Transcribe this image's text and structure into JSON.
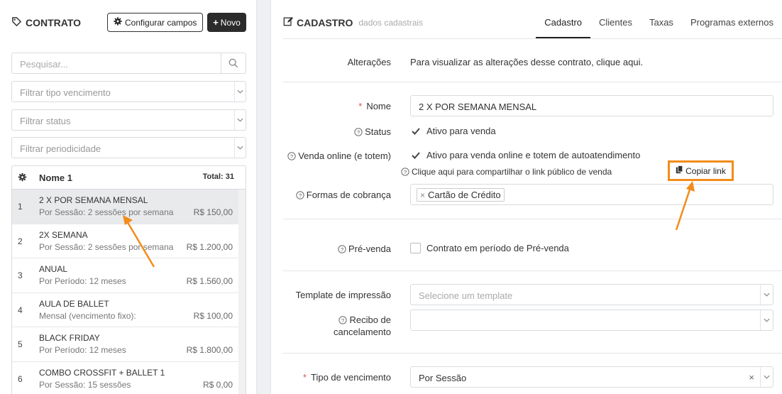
{
  "left": {
    "title": "CONTRATO",
    "config_button": "Configurar campos",
    "new_button": "Novo",
    "search_placeholder": "Pesquisar...",
    "filters": [
      "Filtrar tipo vencimento",
      "Filtrar status",
      "Filtrar periodicidade"
    ],
    "list": {
      "header_name": "Nome 1",
      "header_total": "Total: 31",
      "rows": [
        {
          "idx": "1",
          "name": "2 X POR SEMANA MENSAL",
          "detail": "Por Sessão: 2 sessões por semana",
          "price": "R$ 150,00",
          "selected": true
        },
        {
          "idx": "2",
          "name": "2X SEMANA",
          "detail": "Por Sessão: 2 sessões por semana",
          "price": "R$ 1.200,00"
        },
        {
          "idx": "3",
          "name": "ANUAL",
          "detail": "Por Período: 12 meses",
          "price": "R$ 1.560,00"
        },
        {
          "idx": "4",
          "name": "AULA DE BALLET",
          "detail": "Mensal (vencimento fixo):",
          "price": "R$ 100,00"
        },
        {
          "idx": "5",
          "name": "BLACK FRIDAY",
          "detail": "Por Período: 12 meses",
          "price": "R$ 1.800,00"
        },
        {
          "idx": "6",
          "name": "COMBO CROSSFIT + BALLET 1",
          "detail": "Por Sessão: 15 sessões",
          "price": "R$ 0,00"
        }
      ]
    }
  },
  "right": {
    "title": "CADASTRO",
    "subtitle": "dados cadastrais",
    "tabs": [
      "Cadastro",
      "Clientes",
      "Taxas",
      "Programas externos"
    ],
    "alteracoes_label": "Alterações",
    "alteracoes_text": "Para visualizar as alterações desse contrato, clique aqui.",
    "nome_label": "Nome",
    "nome_value": "2 X POR SEMANA MENSAL",
    "status_label": "Status",
    "status_check": "Ativo para venda",
    "venda_label": "Venda online (e totem)",
    "venda_check": "Ativo para venda online e totem de autoatendimento",
    "share_text": "Clique aqui para compartilhar o link público de venda",
    "copy_link": "Copiar link",
    "formas_label": "Formas de cobrança",
    "formas_tag": "Cartão de Crédito",
    "prevenda_label": "Pré-venda",
    "prevenda_check": "Contrato em período de Pré-venda",
    "template_label": "Template de impressão",
    "template_placeholder": "Selecione um template",
    "recibo_label_1": "Recibo de",
    "recibo_label_2": "cancelamento",
    "tipo_label": "Tipo de vencimento",
    "tipo_value": "Por Sessão"
  },
  "colors": {
    "accent": "#f28c1a",
    "dark_button": "#2b2b2b",
    "required": "#d9534f"
  }
}
